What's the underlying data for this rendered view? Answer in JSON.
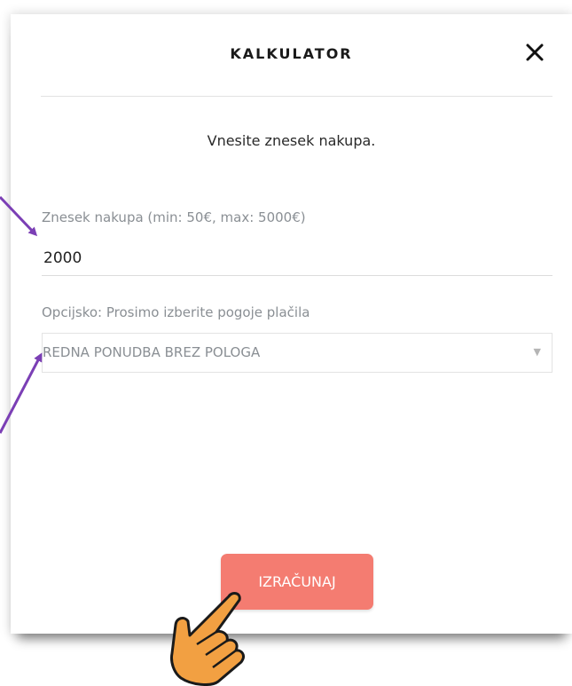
{
  "modal": {
    "title": "KALKULATOR",
    "instruction": "Vnesite znesek nakupa."
  },
  "amount": {
    "label": "Znesek nakupa (min: 50€, max: 5000€)",
    "value": "2000"
  },
  "payment": {
    "label": "Opcijsko: Prosimo izberite pogoje plačila",
    "selected": "REDNA PONUDBA BREZ POLOGA"
  },
  "button": {
    "label": "IZRAČUNAJ"
  },
  "icons": {
    "close": "close-icon",
    "dropdown": "dropdown-arrow-icon",
    "pointer": "pointing-hand-icon"
  },
  "colors": {
    "button": "#f47c71",
    "annotation_arrow": "#7b3fb5",
    "hand": "#f2a042"
  }
}
